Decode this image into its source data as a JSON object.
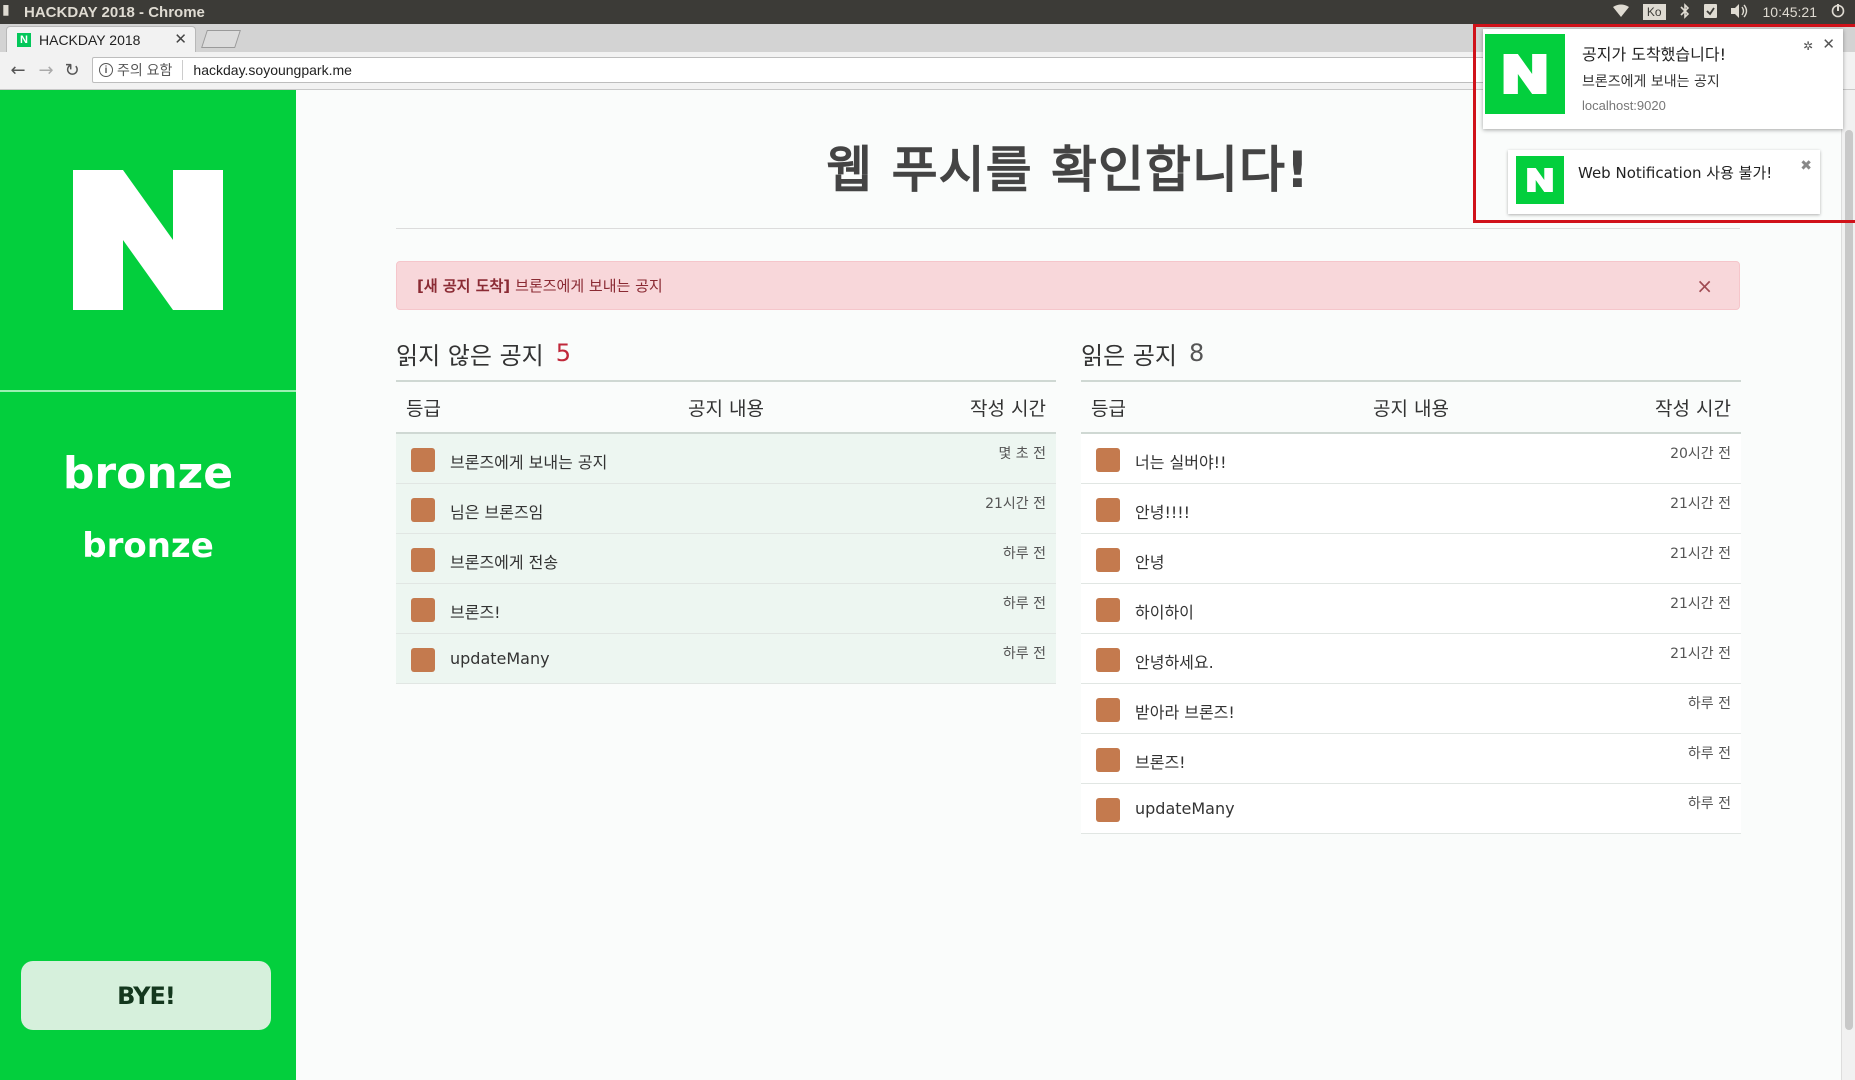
{
  "os": {
    "window_title": "HACKDAY 2018 - Chrome",
    "left_mark": "▮",
    "keyboard": "Ko",
    "clock": "10:45:21"
  },
  "browser": {
    "tab_title": "HACKDAY 2018",
    "tab_favicon": "N",
    "security_label": "주의 요함",
    "url": "hackday.soyoungpark.me"
  },
  "sidebar": {
    "grade_primary": "bronze",
    "grade_secondary": "bronze",
    "bye_label": "BYE!"
  },
  "main": {
    "title": "웹 푸시를 확인합니다!",
    "alert": {
      "tag": "[새 공지 도착]",
      "message": "브론즈에게 보내는 공지",
      "close": "×"
    },
    "columns_header": {
      "grade": "등급",
      "content": "공지 내용",
      "time": "작성 시간"
    },
    "unread": {
      "title": "읽지 않은 공지",
      "count": "5",
      "rows": [
        {
          "content": "브론즈에게 보내는 공지",
          "time": "몇 초 전"
        },
        {
          "content": "님은 브론즈임",
          "time": "21시간 전"
        },
        {
          "content": "브론즈에게 전송",
          "time": "하루 전"
        },
        {
          "content": "브론즈!",
          "time": "하루 전"
        },
        {
          "content": "updateMany",
          "time": "하루 전"
        }
      ]
    },
    "read": {
      "title": "읽은 공지",
      "count": "8",
      "rows": [
        {
          "content": "너는 실버야!!",
          "time": "20시간 전"
        },
        {
          "content": "안녕!!!!",
          "time": "21시간 전"
        },
        {
          "content": "안녕",
          "time": "21시간 전"
        },
        {
          "content": "하이하이",
          "time": "21시간 전"
        },
        {
          "content": "안녕하세요.",
          "time": "21시간 전"
        },
        {
          "content": "받아라 브론즈!",
          "time": "하루 전"
        },
        {
          "content": "브론즈!",
          "time": "하루 전"
        },
        {
          "content": "updateMany",
          "time": "하루 전"
        }
      ]
    }
  },
  "notifications": [
    {
      "title": "공지가 도착했습니다!",
      "body": "브론즈에게 보내는 공지",
      "origin": "localhost:9020"
    },
    {
      "title": "Web Notification 사용 불가!"
    }
  ],
  "colors": {
    "brand_green": "#03cf3d",
    "bronze_badge": "#c47a4e",
    "alert_bg": "#f8d7da",
    "unread_count": "#c0283a",
    "highlight_frame": "#d0121a"
  }
}
